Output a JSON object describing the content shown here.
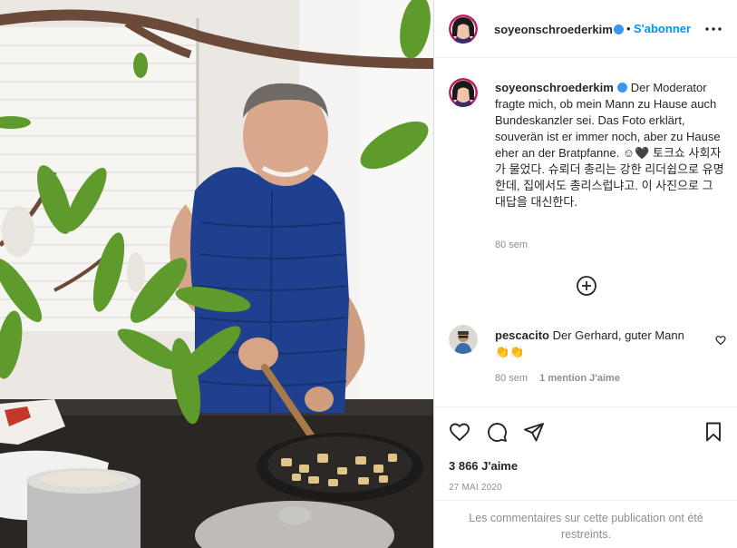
{
  "post": {
    "author": "soyeonschroederkim",
    "follow_label": "S'abonner",
    "separator": "•",
    "more_icon": "more-horizontal-icon",
    "verified_icon": "verified-badge-icon"
  },
  "caption": {
    "username": "soyeonschroederkim",
    "text": "Der Moderator fragte mich, ob mein Mann zu Hause auch Bundeskanzler sei. Das Foto erklärt, souverän ist er immer noch, aber zu Hause eher an der Bratpfanne. ☺🖤 토크쇼 사회자가 물었다. 슈뢰더 총리는 강한 리더쉽으로 유명한데, 집에서도 총리스럽냐고. 이 사진으로 그 대답을 대신한다.",
    "age": "80 sem"
  },
  "load_more_icon": "plus-circle-icon",
  "comments": [
    {
      "username": "pescacito",
      "text": "Der Gerhard, guter Mann 👏👏",
      "age": "80 sem",
      "likes": "1 mention J'aime",
      "like_icon": "heart-outline-icon"
    }
  ],
  "actions": {
    "like_icon": "heart-icon",
    "comment_icon": "comment-icon",
    "share_icon": "paper-plane-icon",
    "save_icon": "bookmark-icon"
  },
  "likes_count": "3 866 J'aime",
  "date": "27 MAI 2020",
  "comments_restricted": "Les commentaires sur cette publication ont été restreints.",
  "colors": {
    "link_blue": "#0095f6",
    "verified_blue": "#3897f0",
    "vest_blue": "#1f3f8f",
    "secondary_text": "#8e8e8e",
    "border": "#dbdbdb"
  }
}
